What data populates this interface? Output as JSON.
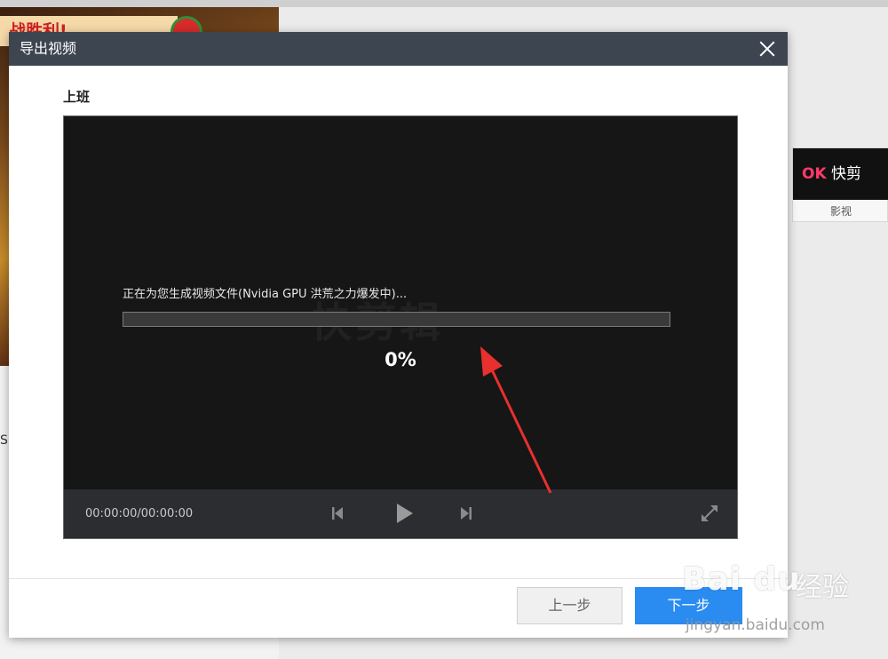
{
  "background": {
    "thumb_banner": "战胜利!",
    "card_label": "影视",
    "card_logo_brand": "OK",
    "card_logo_text": "快剪",
    "partial_text": "S"
  },
  "dialog": {
    "title": "导出视频",
    "project_name": "上班",
    "status_text": "正在为您生成视频文件(Nvidia GPU 洪荒之力爆发中)...",
    "progress_percent_label": "0%",
    "progress": 0,
    "watermark": "快剪辑",
    "time_readout": "00:00:00/00:00:00",
    "controls": {
      "prev_icon": "skip-back-icon",
      "play_icon": "play-icon",
      "next_icon": "skip-forward-icon",
      "fullscreen_icon": "fullscreen-icon"
    },
    "buttons": {
      "prev_label": "上一步",
      "next_label": "下一步"
    }
  },
  "baidu_watermark": {
    "logo_text": "Bai du",
    "cn_text": "经验",
    "url": "jingyan.baidu.com"
  },
  "colors": {
    "header_bg": "#3d4550",
    "primary_button": "#2a8cf0",
    "annotation_arrow": "#e8302e",
    "player_bg": "#161616"
  }
}
